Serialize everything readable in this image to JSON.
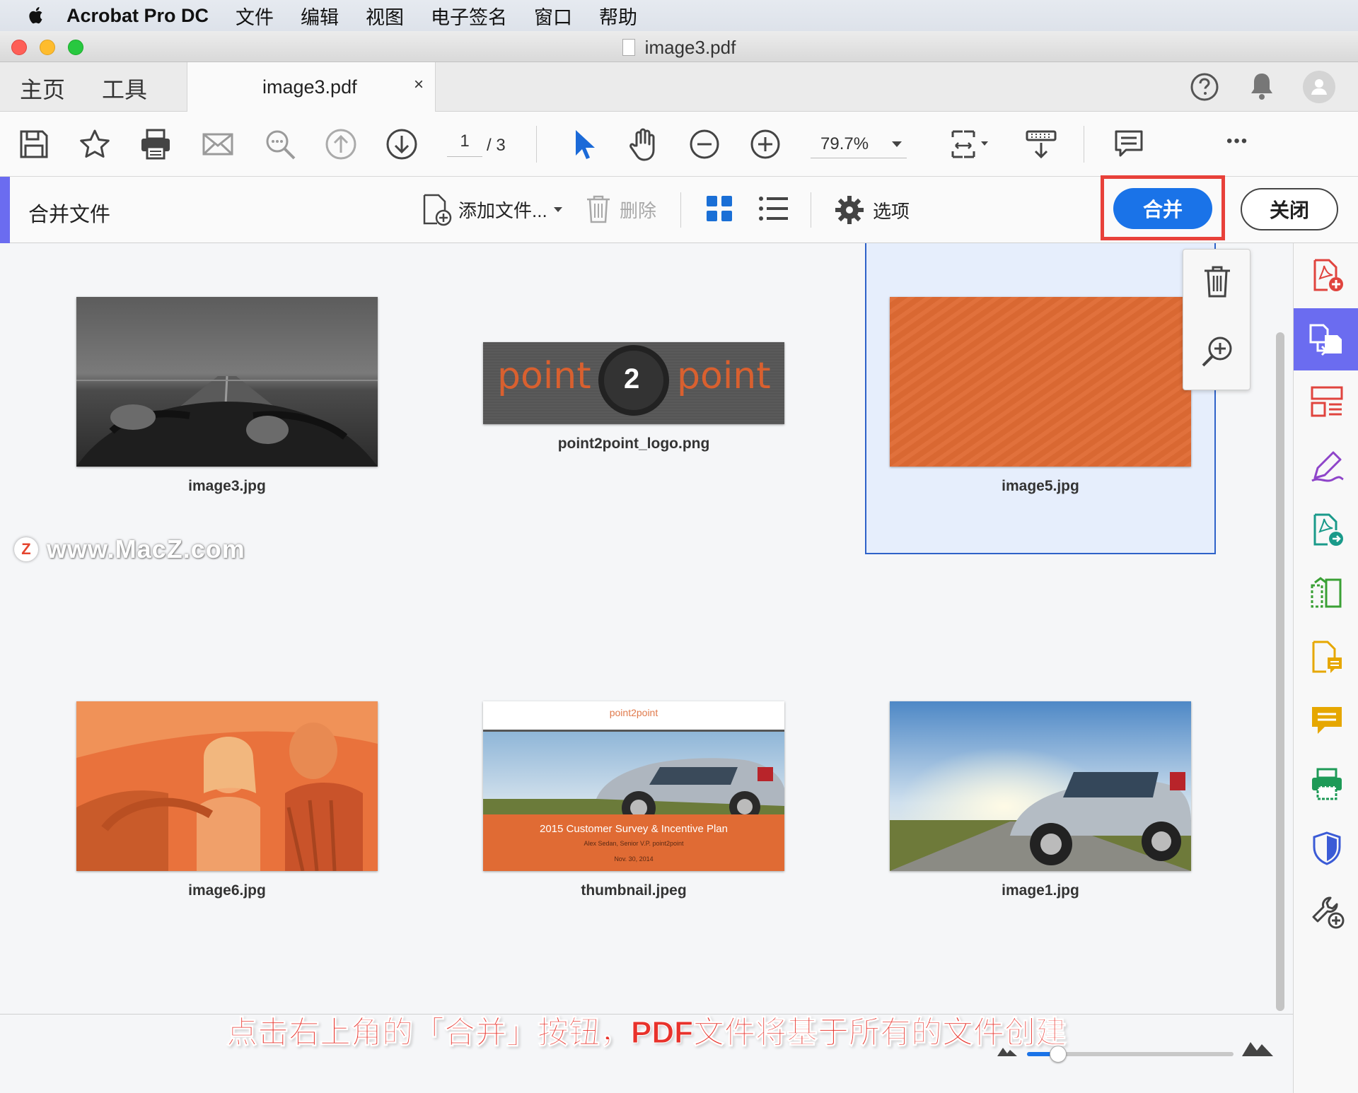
{
  "menubar": {
    "app_name": "Acrobat Pro DC",
    "items": [
      "文件",
      "编辑",
      "视图",
      "电子签名",
      "窗口",
      "帮助"
    ]
  },
  "window": {
    "title": "image3.pdf"
  },
  "tabs": {
    "home": "主页",
    "tools": "工具",
    "doc_tab": "image3.pdf",
    "close_glyph": "×"
  },
  "toolbar": {
    "page_current": "1",
    "page_total": "/ 3",
    "zoom": "79.7%",
    "more": "•••"
  },
  "combine": {
    "title": "合并文件",
    "add_files": "添加文件...",
    "delete": "删除",
    "options": "选项",
    "merge": "合并",
    "close": "关闭"
  },
  "files": [
    {
      "name": "image3.jpg"
    },
    {
      "name": "point2point_logo.png",
      "logo_left": "point",
      "logo_num": "2",
      "logo_right": "point"
    },
    {
      "name": "image5.jpg"
    },
    {
      "name": "image6.jpg"
    },
    {
      "name": "thumbnail.jpeg",
      "slide_brand": "point2point",
      "slide_title": "2015 Customer Survey & Incentive Plan",
      "slide_author": "Alex Sedan, Senior V.P. point2point",
      "slide_date": "Nov. 30, 2014"
    },
    {
      "name": "image1.jpg"
    }
  ],
  "watermark": {
    "badge": "Z",
    "text": "www.MacZ.com"
  },
  "subtitle": "点击右上角的「合并」按钮，PDF文件将基于所有的文件创建",
  "thumbnail_size_slider": {
    "value": 0.15
  },
  "colors": {
    "accent": "#6b6cf0",
    "merge_blue": "#1a73e8",
    "highlight_red": "#e8413a",
    "orange": "#e06b34",
    "selected_bg": "#e6eefc",
    "selected_border": "#2e62c9"
  },
  "icons": [
    "save-icon",
    "star-icon",
    "print-icon",
    "mail-icon",
    "search-icon",
    "page-up-icon",
    "page-down-icon",
    "cursor-icon",
    "hand-icon",
    "zoom-out-icon",
    "zoom-in-icon",
    "fit-page-icon",
    "scroll-mode-icon",
    "comment-icon",
    "help-icon",
    "bell-icon",
    "user-icon",
    "trash-icon",
    "grid-view-icon",
    "list-view-icon",
    "gear-icon"
  ]
}
